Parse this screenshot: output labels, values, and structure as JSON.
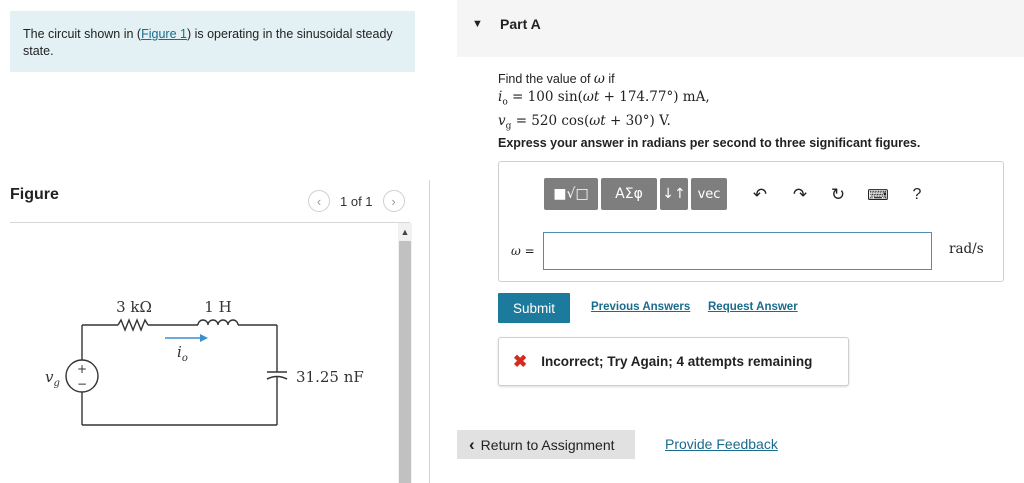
{
  "intro": {
    "text_before": "The circuit shown in (",
    "link": "Figure 1",
    "text_after": ") is operating in the sinusoidal steady state."
  },
  "figure": {
    "title": "Figure",
    "pager": "1 of 1",
    "prev_icon": "chevron-left-icon",
    "next_icon": "chevron-right-icon"
  },
  "circuit": {
    "resistor": "3 kΩ",
    "inductor": "1 H",
    "current": "i",
    "current_sub": "o",
    "source": "v",
    "source_sub": "g",
    "capacitor": "31.25 nF",
    "plus": "+",
    "minus": "−"
  },
  "part_a": {
    "title": "Part A",
    "prompt": "Find the value of ω if",
    "eq1": "i_o = 100 sin(ωt + 174.77°) mA,",
    "eq2": "v_g = 520 cos(ωt + 30°) V.",
    "instruction": "Express your answer in radians per second to three significant figures."
  },
  "toolbar": {
    "templates": "■√□",
    "greek": "ΑΣφ",
    "arrows": "↓↑",
    "vec": "vec",
    "help": "?"
  },
  "answer": {
    "label": "ω =",
    "value": "",
    "units": "rad/s"
  },
  "actions": {
    "submit": "Submit",
    "previous_answers": "Previous Answers",
    "request_answer": "Request Answer"
  },
  "feedback": {
    "text": "Incorrect; Try Again; 4 attempts remaining"
  },
  "footer": {
    "return": "Return to Assignment",
    "provide_feedback": "Provide Feedback"
  }
}
